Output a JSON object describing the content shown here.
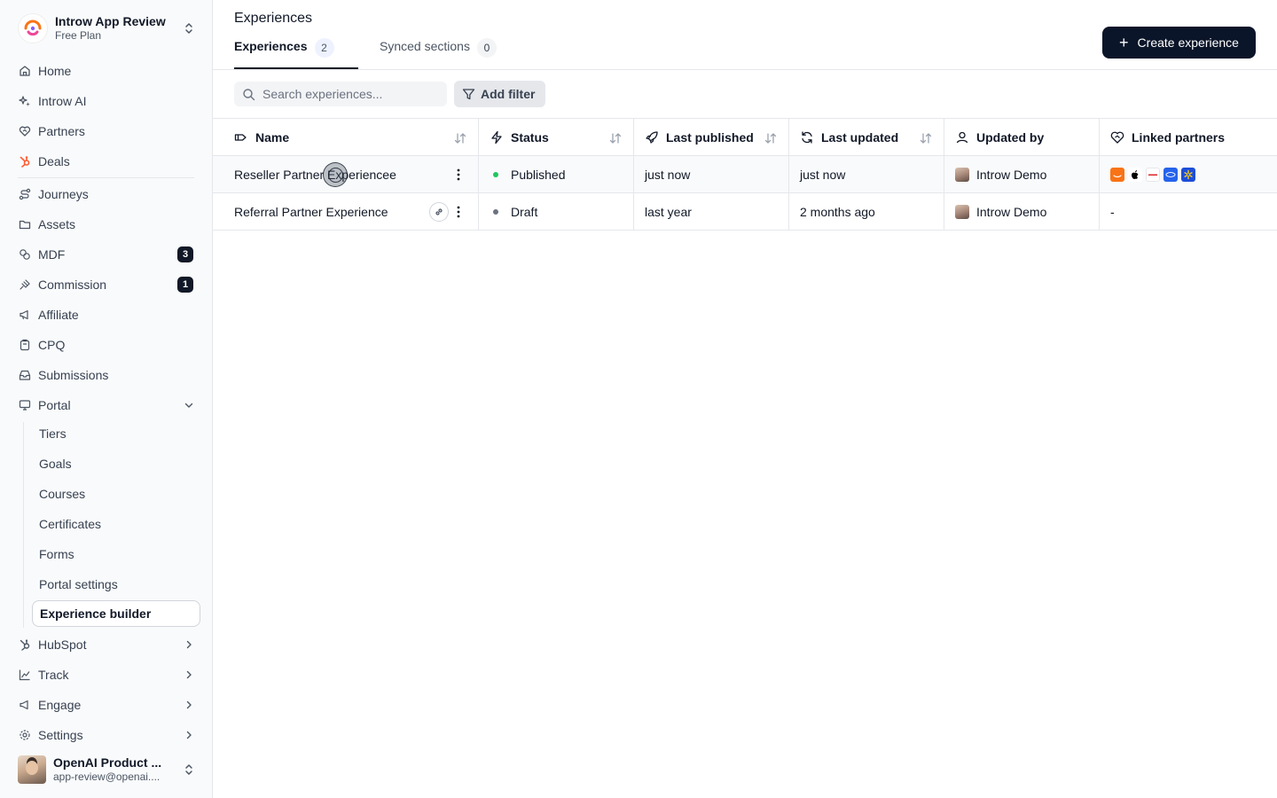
{
  "workspace": {
    "name": "Introw App Review",
    "plan": "Free Plan"
  },
  "sidebar": {
    "items": [
      {
        "label": "Home",
        "icon": "home-icon"
      },
      {
        "label": "Introw AI",
        "icon": "sparkle-icon"
      },
      {
        "label": "Partners",
        "icon": "handshake-icon"
      },
      {
        "label": "Deals",
        "icon": "hubspot-icon"
      },
      {
        "label": "Journeys",
        "icon": "route-icon"
      },
      {
        "label": "Assets",
        "icon": "folder-icon"
      },
      {
        "label": "MDF",
        "icon": "coins-icon",
        "badge": "3"
      },
      {
        "label": "Commission",
        "icon": "money-icon",
        "badge": "1"
      },
      {
        "label": "Affiliate",
        "icon": "megaphone-icon"
      },
      {
        "label": "CPQ",
        "icon": "clipboard-icon"
      },
      {
        "label": "Submissions",
        "icon": "inbox-icon"
      },
      {
        "label": "Portal",
        "icon": "monitor-icon"
      }
    ],
    "portal_sub": [
      "Tiers",
      "Goals",
      "Courses",
      "Certificates",
      "Forms",
      "Portal settings",
      "Experience builder"
    ],
    "bottom_items": [
      {
        "label": "HubSpot",
        "icon": "hubspot-icon"
      },
      {
        "label": "Track",
        "icon": "chart-icon"
      },
      {
        "label": "Engage",
        "icon": "megaphone-icon"
      },
      {
        "label": "Settings",
        "icon": "gear-icon"
      }
    ]
  },
  "user": {
    "name": "OpenAI Product ...",
    "email": "app-review@openai...."
  },
  "header": {
    "title": "Experiences",
    "tabs": [
      {
        "label": "Experiences",
        "count": "2"
      },
      {
        "label": "Synced sections",
        "count": "0"
      }
    ],
    "create_label": "Create experience"
  },
  "toolbar": {
    "search_placeholder": "Search experiences...",
    "filter_label": "Add filter"
  },
  "table": {
    "columns": [
      "Name",
      "Status",
      "Last published",
      "Last updated",
      "Updated by",
      "Linked partners"
    ],
    "rows": [
      {
        "name": "Reseller Partner Experiencee",
        "status": "Published",
        "status_color": "#22c55e",
        "last_published": "just now",
        "last_updated": "just now",
        "updated_by": "Introw Demo",
        "linked_partners": ""
      },
      {
        "name": "Referral Partner Experience",
        "status": "Draft",
        "status_color": "#6b7280",
        "last_published": "last year",
        "last_updated": "2 months ago",
        "updated_by": "Introw Demo",
        "linked_partners": "-"
      }
    ]
  },
  "colors": {
    "primary_button": "#0b1529",
    "published": "#22c55e",
    "draft": "#6b7280"
  }
}
